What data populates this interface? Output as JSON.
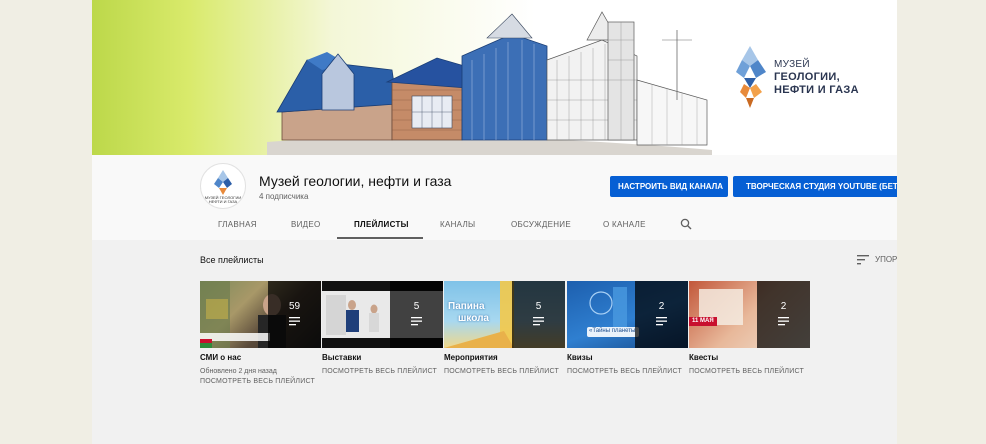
{
  "banner": {
    "logo_line1": "МУЗЕЙ",
    "logo_line2": "ГЕОЛОГИИ,",
    "logo_line3": "НЕФТИ И ГАЗА"
  },
  "channel": {
    "title": "Музей геологии, нефти и газа",
    "subscribers": "4 подписчика",
    "avatar_text": "МУЗЕЙ ГЕОЛОГИИ НЕФТИ И ГАЗА",
    "customize_button": "НАСТРОИТЬ ВИД КАНАЛА",
    "studio_button": "ТВОРЧЕСКАЯ СТУДИЯ YOUTUBE (БЕТА-ВЕРСИЯ)"
  },
  "tabs": [
    "ГЛАВНАЯ",
    "ВИДЕО",
    "ПЛЕЙЛИСТЫ",
    "КАНАЛЫ",
    "ОБСУЖДЕНИЕ",
    "О КАНАЛЕ"
  ],
  "active_tab": "ПЛЕЙЛИСТЫ",
  "section": {
    "title": "Все плейлисты",
    "sort_label": "УПОРЯДОЧИТЬ"
  },
  "playlists": [
    {
      "title": "СМИ о нас",
      "count": "59",
      "updated": "Обновлено 2 дня назад",
      "link": "ПОСМОТРЕТЬ ВЕСЬ ПЛЕЙЛИСТ"
    },
    {
      "title": "Выставки",
      "count": "5",
      "link": "ПОСМОТРЕТЬ ВЕСЬ ПЛЕЙЛИСТ"
    },
    {
      "title": "Мероприятия",
      "count": "5",
      "link": "ПОСМОТРЕТЬ ВЕСЬ ПЛЕЙЛИСТ"
    },
    {
      "title": "Квизы",
      "count": "2",
      "link": "ПОСМОТРЕТЬ ВЕСЬ ПЛЕЙЛИСТ"
    },
    {
      "title": "Квесты",
      "count": "2",
      "link": "ПОСМОТРЕТЬ ВЕСЬ ПЛЕЙЛИСТ"
    }
  ],
  "thumb_text": {
    "t3_line1": "Папина",
    "t3_line2": "школа",
    "t4_line1": "«Тайны планеты",
    "t5_date": "11 МАЯ"
  },
  "colors": {
    "accent_blue": "#065fd4",
    "tab_active": "#0f0f0f",
    "tab_inactive": "#606060",
    "background": "#f1f1f1"
  },
  "icons": {
    "search": "search-icon",
    "sort": "sort-icon",
    "playlist": "playlist-icon",
    "logo": "crystal-logo-icon"
  }
}
